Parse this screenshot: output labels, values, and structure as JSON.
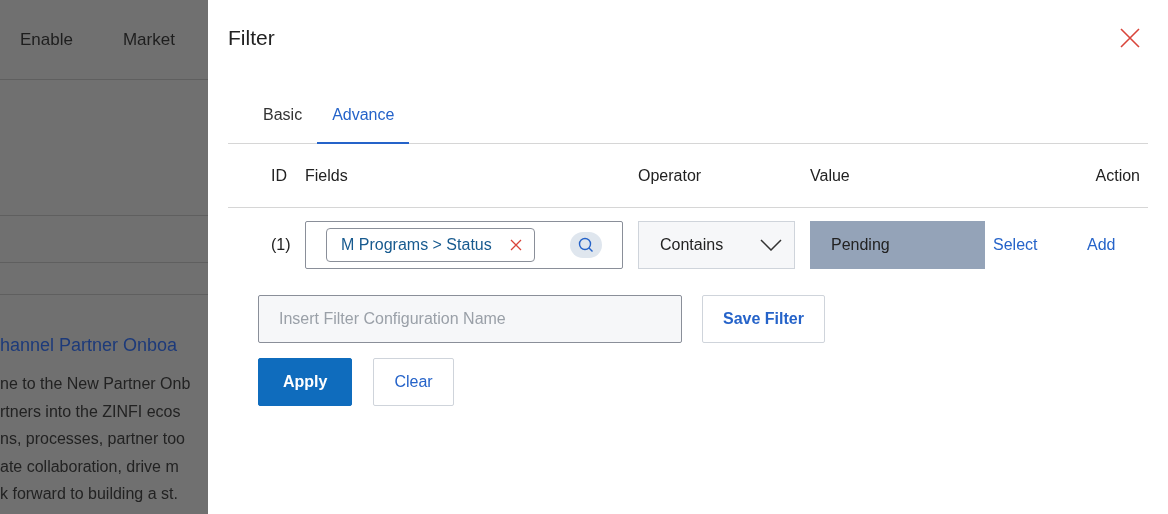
{
  "background": {
    "nav": [
      "Enable",
      "Market"
    ],
    "heading": "hannel Partner Onboa",
    "paragraph_lines": [
      "ne to the New Partner Onb",
      "rtners into the ZINFI ecos",
      "ns, processes, partner too",
      "ate collaboration, drive m",
      "k forward to building a st."
    ]
  },
  "dialog": {
    "title": "Filter",
    "tabs": [
      {
        "label": "Basic",
        "selected": false
      },
      {
        "label": "Advance",
        "selected": true
      }
    ],
    "columns": [
      "ID",
      "Fields",
      "Operator",
      "Value",
      "Action"
    ],
    "rows": [
      {
        "id": "(1)",
        "field_chip": "M Programs > Status",
        "operator": "Contains",
        "value": "Pending",
        "select_link": "Select",
        "add_link": "Add"
      }
    ],
    "config_name": {
      "placeholder": "Insert Filter Configuration Name"
    },
    "save_button": "Save Filter",
    "apply_button": "Apply",
    "clear_button": "Clear"
  }
}
